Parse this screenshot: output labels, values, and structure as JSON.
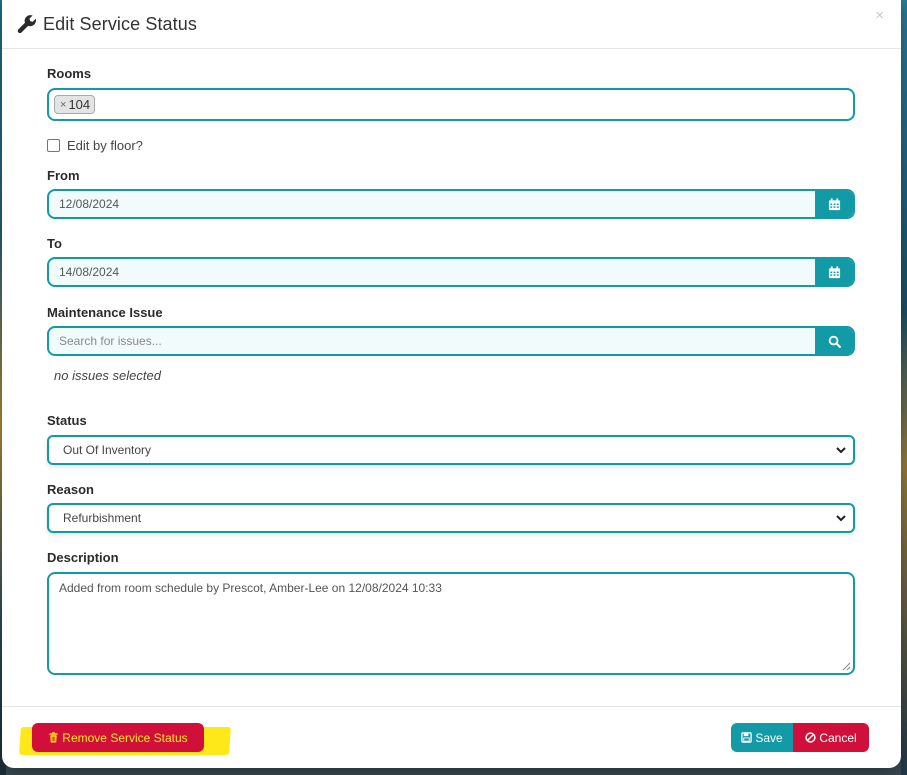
{
  "modal": {
    "title": "Edit Service Status",
    "close_label": "×"
  },
  "rooms": {
    "label": "Rooms",
    "tags": [
      {
        "remove": "×",
        "value": "104"
      }
    ]
  },
  "edit_by_floor": {
    "label": "Edit by floor?",
    "checked": false
  },
  "from": {
    "label": "From",
    "value": "12/08/2024"
  },
  "to": {
    "label": "To",
    "value": "14/08/2024"
  },
  "maintenance": {
    "label": "Maintenance Issue",
    "placeholder": "Search for issues...",
    "empty_text": "no issues selected"
  },
  "status": {
    "label": "Status",
    "selected": "Out Of Inventory"
  },
  "reason": {
    "label": "Reason",
    "selected": "Refurbishment"
  },
  "description": {
    "label": "Description",
    "value": "Added from room schedule by Prescot, Amber-Lee on 12/08/2024 10:33"
  },
  "footer": {
    "remove_label": "Remove Service Status",
    "save_label": "Save",
    "cancel_label": "Cancel"
  },
  "colors": {
    "accent": "#129aa6",
    "danger": "#d0103a",
    "highlight": "#ffe81a"
  }
}
